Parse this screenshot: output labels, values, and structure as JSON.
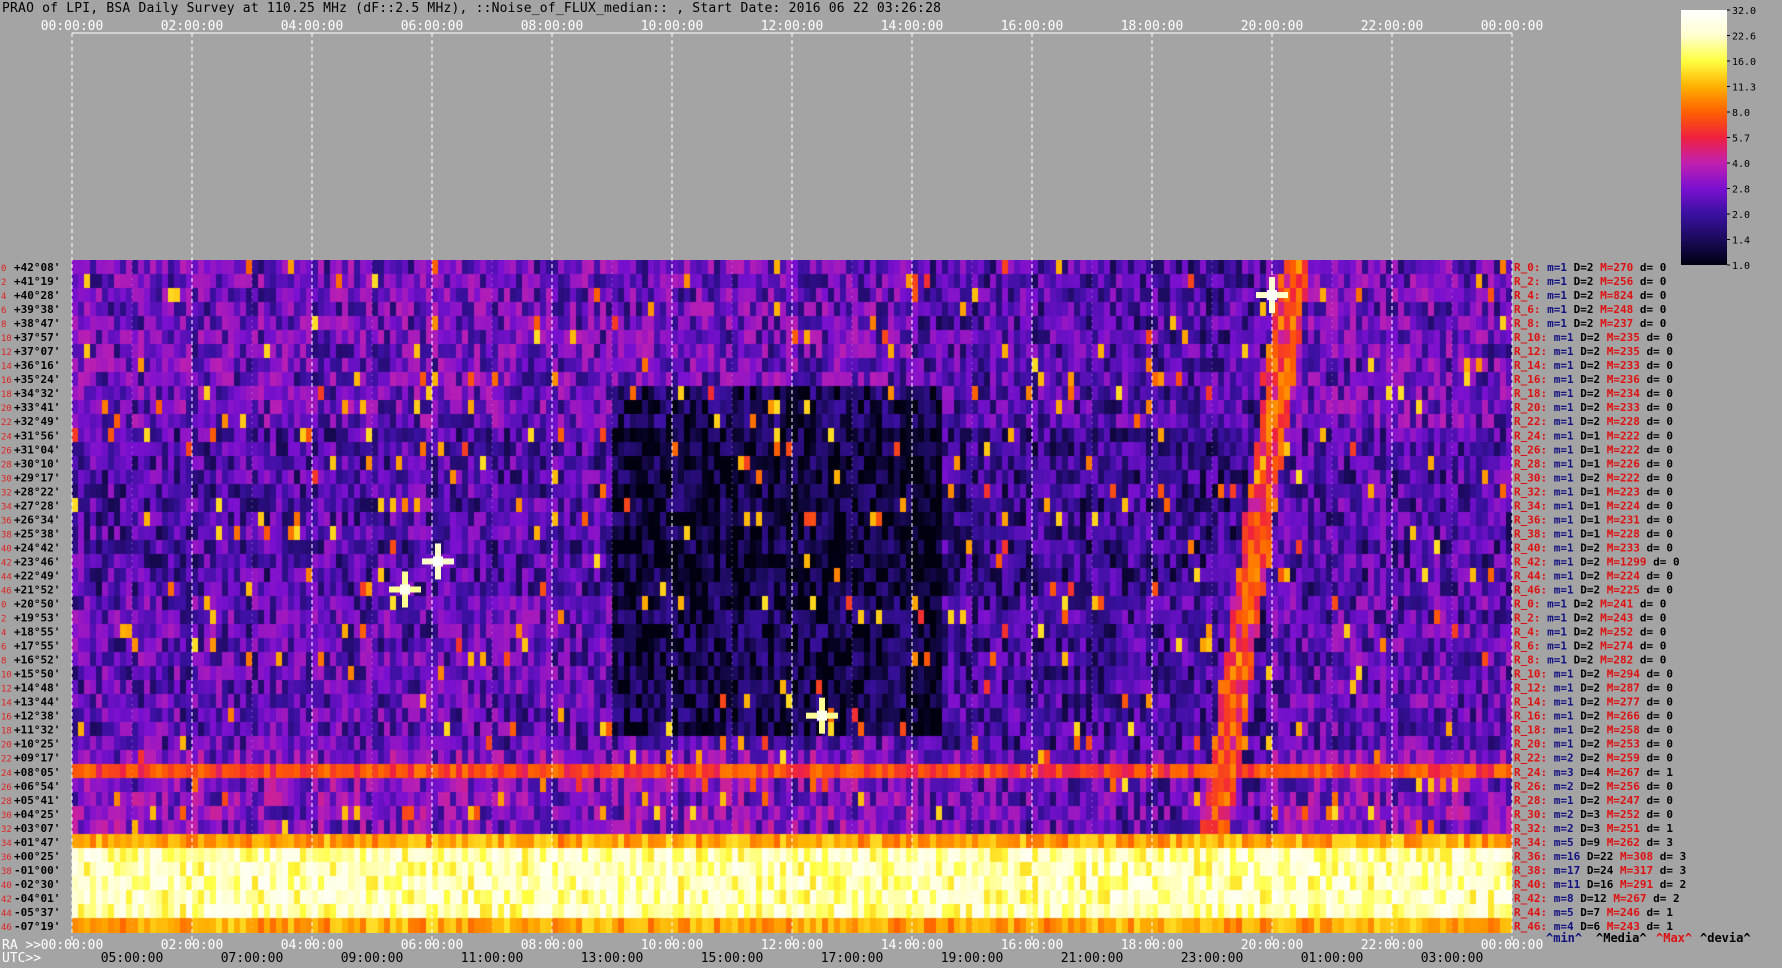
{
  "title": "PRAO of LPI, BSA Daily Survey at 110.25 MHz (dF::2.5 MHz), ::Noise_of_FLUX_median:: , Start Date: 2016 06 22 03:26:28",
  "chart_data": {
    "type": "heatmap",
    "title": "PRAO of LPI, BSA Daily Survey at 110.25 MHz (dF::2.5 MHz), ::Noise_of_FLUX_median:: , Start Date: 2016 06 22 03:26:28",
    "ra_ticks": [
      "00:00:00",
      "02:00:00",
      "04:00:00",
      "06:00:00",
      "08:00:00",
      "10:00:00",
      "12:00:00",
      "14:00:00",
      "16:00:00",
      "18:00:00",
      "20:00:00",
      "22:00:00",
      "00:00:00"
    ],
    "ra_axis_label": "RA >>",
    "utc_axis_label": "UTC>>",
    "utc_ticks": [
      "05:00:00",
      "07:00:00",
      "09:00:00",
      "11:00:00",
      "13:00:00",
      "15:00:00",
      "17:00:00",
      "19:00:00",
      "21:00:00",
      "23:00:00",
      "01:00:00",
      "03:00:00"
    ],
    "declinations": [
      "+42°08'",
      "+41°19'",
      "+40°28'",
      "+39°38'",
      "+38°47'",
      "+37°57'",
      "+37°07'",
      "+36°16'",
      "+35°24'",
      "+34°32'",
      "+33°41'",
      "+32°49'",
      "+31°56'",
      "+31°04'",
      "+30°10'",
      "+29°17'",
      "+28°22'",
      "+27°28'",
      "+26°34'",
      "+25°38'",
      "+24°42'",
      "+23°46'",
      "+22°49'",
      "+21°52'",
      "+20°50'",
      "+19°53'",
      "+18°55'",
      "+17°55'",
      "+16°52'",
      "+15°50'",
      "+14°48'",
      "+13°44'",
      "+12°38'",
      "+11°32'",
      "+10°25'",
      "+09°17'",
      "+08°05'",
      "+06°54'",
      "+05°41'",
      "+04°25'",
      "+03°07'",
      "+01°47'",
      "+00°25'",
      "-01°00'",
      "-02°30'",
      "-04°01'",
      "-05°37'",
      "-07°19'"
    ],
    "row_indices": [
      "0",
      "2",
      "4",
      "6",
      "8",
      "10",
      "12",
      "14",
      "16",
      "18",
      "20",
      "22",
      "24",
      "26",
      "28",
      "30",
      "32",
      "34",
      "36",
      "38",
      "40",
      "42",
      "44",
      "46",
      "0",
      "2",
      "4",
      "6",
      "8",
      "10",
      "12",
      "14",
      "16",
      "18",
      "20",
      "22",
      "24",
      "26",
      "28",
      "30",
      "32",
      "34",
      "36",
      "38",
      "40",
      "42",
      "44",
      "46"
    ],
    "colorbar": {
      "ticks": [
        "32.0",
        "22.6",
        "16.0",
        "11.3",
        "8.0",
        "5.7",
        "4.0",
        "2.8",
        "2.0",
        "1.4",
        "1.0"
      ],
      "scale": "log",
      "range": [
        1.0,
        32.0
      ],
      "colors": [
        "#000010",
        "#1a0a5a",
        "#3a10a0",
        "#7a10d0",
        "#c020b0",
        "#f02040",
        "#ff6000",
        "#ffb000",
        "#ffff40",
        "#ffffd0",
        "#ffffff"
      ]
    },
    "row_stats": [
      {
        "r": "R_0:",
        "m": "m=1",
        "D": "D=2",
        "M": "M=270",
        "d": "d= 0"
      },
      {
        "r": "R_2:",
        "m": "m=1",
        "D": "D=2",
        "M": "M=256",
        "d": "d= 0"
      },
      {
        "r": "R_4:",
        "m": "m=1",
        "D": "D=2",
        "M": "M=824",
        "d": "d= 0"
      },
      {
        "r": "R_6:",
        "m": "m=1",
        "D": "D=2",
        "M": "M=248",
        "d": "d= 0"
      },
      {
        "r": "R_8:",
        "m": "m=1",
        "D": "D=2",
        "M": "M=237",
        "d": "d= 0"
      },
      {
        "r": "R_10:",
        "m": "m=1",
        "D": "D=2",
        "M": "M=235",
        "d": "d= 0"
      },
      {
        "r": "R_12:",
        "m": "m=1",
        "D": "D=2",
        "M": "M=235",
        "d": "d= 0"
      },
      {
        "r": "R_14:",
        "m": "m=1",
        "D": "D=2",
        "M": "M=233",
        "d": "d= 0"
      },
      {
        "r": "R_16:",
        "m": "m=1",
        "D": "D=2",
        "M": "M=236",
        "d": "d= 0"
      },
      {
        "r": "R_18:",
        "m": "m=1",
        "D": "D=2",
        "M": "M=234",
        "d": "d= 0"
      },
      {
        "r": "R_20:",
        "m": "m=1",
        "D": "D=2",
        "M": "M=233",
        "d": "d= 0"
      },
      {
        "r": "R_22:",
        "m": "m=1",
        "D": "D=2",
        "M": "M=228",
        "d": "d= 0"
      },
      {
        "r": "R_24:",
        "m": "m=1",
        "D": "D=1",
        "M": "M=222",
        "d": "d= 0"
      },
      {
        "r": "R_26:",
        "m": "m=1",
        "D": "D=1",
        "M": "M=222",
        "d": "d= 0"
      },
      {
        "r": "R_28:",
        "m": "m=1",
        "D": "D=1",
        "M": "M=226",
        "d": "d= 0"
      },
      {
        "r": "R_30:",
        "m": "m=1",
        "D": "D=2",
        "M": "M=222",
        "d": "d= 0"
      },
      {
        "r": "R_32:",
        "m": "m=1",
        "D": "D=1",
        "M": "M=223",
        "d": "d= 0"
      },
      {
        "r": "R_34:",
        "m": "m=1",
        "D": "D=1",
        "M": "M=224",
        "d": "d= 0"
      },
      {
        "r": "R_36:",
        "m": "m=1",
        "D": "D=1",
        "M": "M=231",
        "d": "d= 0"
      },
      {
        "r": "R_38:",
        "m": "m=1",
        "D": "D=1",
        "M": "M=228",
        "d": "d= 0"
      },
      {
        "r": "R_40:",
        "m": "m=1",
        "D": "D=2",
        "M": "M=233",
        "d": "d= 0"
      },
      {
        "r": "R_42:",
        "m": "m=1",
        "D": "D=2",
        "M": "M=1299",
        "d": "d= 0"
      },
      {
        "r": "R_44:",
        "m": "m=1",
        "D": "D=2",
        "M": "M=224",
        "d": "d= 0"
      },
      {
        "r": "R_46:",
        "m": "m=1",
        "D": "D=2",
        "M": "M=225",
        "d": "d= 0"
      },
      {
        "r": "R_0:",
        "m": "m=1",
        "D": "D=2",
        "M": "M=241",
        "d": "d= 0"
      },
      {
        "r": "R_2:",
        "m": "m=1",
        "D": "D=2",
        "M": "M=243",
        "d": "d= 0"
      },
      {
        "r": "R_4:",
        "m": "m=1",
        "D": "D=2",
        "M": "M=252",
        "d": "d= 0"
      },
      {
        "r": "R_6:",
        "m": "m=1",
        "D": "D=2",
        "M": "M=274",
        "d": "d= 0"
      },
      {
        "r": "R_8:",
        "m": "m=1",
        "D": "D=2",
        "M": "M=282",
        "d": "d= 0"
      },
      {
        "r": "R_10:",
        "m": "m=1",
        "D": "D=2",
        "M": "M=294",
        "d": "d= 0"
      },
      {
        "r": "R_12:",
        "m": "m=1",
        "D": "D=2",
        "M": "M=287",
        "d": "d= 0"
      },
      {
        "r": "R_14:",
        "m": "m=1",
        "D": "D=2",
        "M": "M=277",
        "d": "d= 0"
      },
      {
        "r": "R_16:",
        "m": "m=1",
        "D": "D=2",
        "M": "M=266",
        "d": "d= 0"
      },
      {
        "r": "R_18:",
        "m": "m=1",
        "D": "D=2",
        "M": "M=258",
        "d": "d= 0"
      },
      {
        "r": "R_20:",
        "m": "m=1",
        "D": "D=2",
        "M": "M=253",
        "d": "d= 0"
      },
      {
        "r": "R_22:",
        "m": "m=2",
        "D": "D=2",
        "M": "M=259",
        "d": "d= 0"
      },
      {
        "r": "R_24:",
        "m": "m=3",
        "D": "D=4",
        "M": "M=267",
        "d": "d= 1"
      },
      {
        "r": "R_26:",
        "m": "m=2",
        "D": "D=2",
        "M": "M=256",
        "d": "d= 0"
      },
      {
        "r": "R_28:",
        "m": "m=1",
        "D": "D=2",
        "M": "M=247",
        "d": "d= 0"
      },
      {
        "r": "R_30:",
        "m": "m=2",
        "D": "D=3",
        "M": "M=252",
        "d": "d= 0"
      },
      {
        "r": "R_32:",
        "m": "m=2",
        "D": "D=3",
        "M": "M=251",
        "d": "d= 1"
      },
      {
        "r": "R_34:",
        "m": "m=5",
        "D": "D=9",
        "M": "M=262",
        "d": "d= 3"
      },
      {
        "r": "R_36:",
        "m": "m=16",
        "D": "D=22",
        "M": "M=308",
        "d": "d= 3"
      },
      {
        "r": "R_38:",
        "m": "m=17",
        "D": "D=24",
        "M": "M=317",
        "d": "d= 3"
      },
      {
        "r": "R_40:",
        "m": "m=11",
        "D": "D=16",
        "M": "M=291",
        "d": "d= 2"
      },
      {
        "r": "R_42:",
        "m": "m=8",
        "D": "D=12",
        "M": "M=267",
        "d": "d= 2"
      },
      {
        "r": "R_44:",
        "m": "m=5",
        "D": "D=7",
        "M": "M=246",
        "d": "d= 1"
      },
      {
        "r": "R_46:",
        "m": "m=4",
        "D": "D=6",
        "M": "M=243",
        "d": "d= 1"
      }
    ],
    "legend": [
      {
        "text": "^min^",
        "color": "#101080"
      },
      {
        "text": "^Media^",
        "color": "#000000"
      },
      {
        "text": "^Max^",
        "color": "#e01010"
      },
      {
        "text": "^devia^",
        "color": "#000000"
      }
    ],
    "bright_sources": [
      {
        "ra_hours": 20.0,
        "row": 2,
        "peak": 32
      },
      {
        "ra_hours": 6.1,
        "row": 21,
        "peak": 32
      },
      {
        "ra_hours": 5.55,
        "row": 23,
        "peak": 28
      },
      {
        "ra_hours": 12.5,
        "row": 32,
        "peak": 28
      }
    ]
  }
}
